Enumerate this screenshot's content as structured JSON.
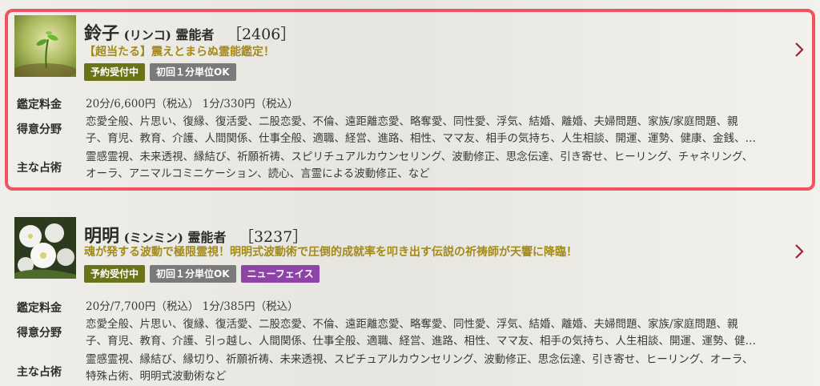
{
  "cards": [
    {
      "name": "鈴子",
      "kana": "(リンコ)",
      "rank": "霊能者",
      "number": "［2406］",
      "catch": "【超当たる】震えとまらぬ霊能鑑定！",
      "badges": [
        "予約受付中",
        "初回１分単位OK"
      ],
      "labels": {
        "fee": "鑑定料金",
        "spec": "得意分野",
        "tech": "主な占術"
      },
      "fee": "20分/6,600円（税込） 1分/330円（税込）",
      "spec_line1": "恋愛全般、片思い、復縁、復活愛、二股恋愛、不倫、遠距離恋愛、略奪愛、同性愛、浮気、結婚、離婚、夫婦問題、家族/家庭問題、親",
      "spec_line2": "子、育児、教育、介護、人間関係、仕事全般、適職、経営、進路、相性、ママ友、相手の気持ち、人生相談、開運、運勢、健康、金銭、…",
      "tech_line1": "霊感霊視、未来透視、縁結び、祈願祈祷、スピリチュアルカウンセリング、波動修正、思念伝達、引き寄せ、ヒーリング、チャネリング、",
      "tech_line2": "オーラ、アニマルコミニケーション、読心、言霊による波動修正、など"
    },
    {
      "name": "明明",
      "kana": "(ミンミン)",
      "rank": "霊能者",
      "number": "［3237］",
      "catch": "魂が発する波動で極限霊視！明明式波動術で圧倒的成就率を叩き出す伝説の祈祷師が天響に降臨！",
      "badges": [
        "予約受付中",
        "初回１分単位OK",
        "ニューフェイス"
      ],
      "labels": {
        "fee": "鑑定料金",
        "spec": "得意分野",
        "tech": "主な占術"
      },
      "fee": "20分/7,700円（税込） 1分/385円（税込）",
      "spec_line1": "恋愛全般、片思い、復縁、復活愛、二股恋愛、不倫、遠距離恋愛、略奪愛、同性愛、浮気、結婚、離婚、夫婦問題、家族/家庭問題、親",
      "spec_line2": "子、育児、教育、介護、引っ越し、人間関係、仕事全般、適職、経営、進路、相性、ママ友、相手の気持ち、人生相談、開運、運勢、健…",
      "tech_line1": "霊感霊視、縁結び、縁切り、祈願祈祷、未来透視、スピチュアルカウンセリング、波動修正、思念伝達、引き寄せ、ヒーリング、オーラ、",
      "tech_line2": "特殊占術、明明式波動術など"
    }
  ],
  "colors": {
    "highlight": "#f0525f",
    "catch": "#a48a17",
    "badge_green": "#6b7317",
    "badge_gray": "#7a7a7a",
    "badge_purple": "#8e44a6",
    "chevron": "#9b2335"
  },
  "icons": {
    "chevron": "chevron-right-icon"
  }
}
